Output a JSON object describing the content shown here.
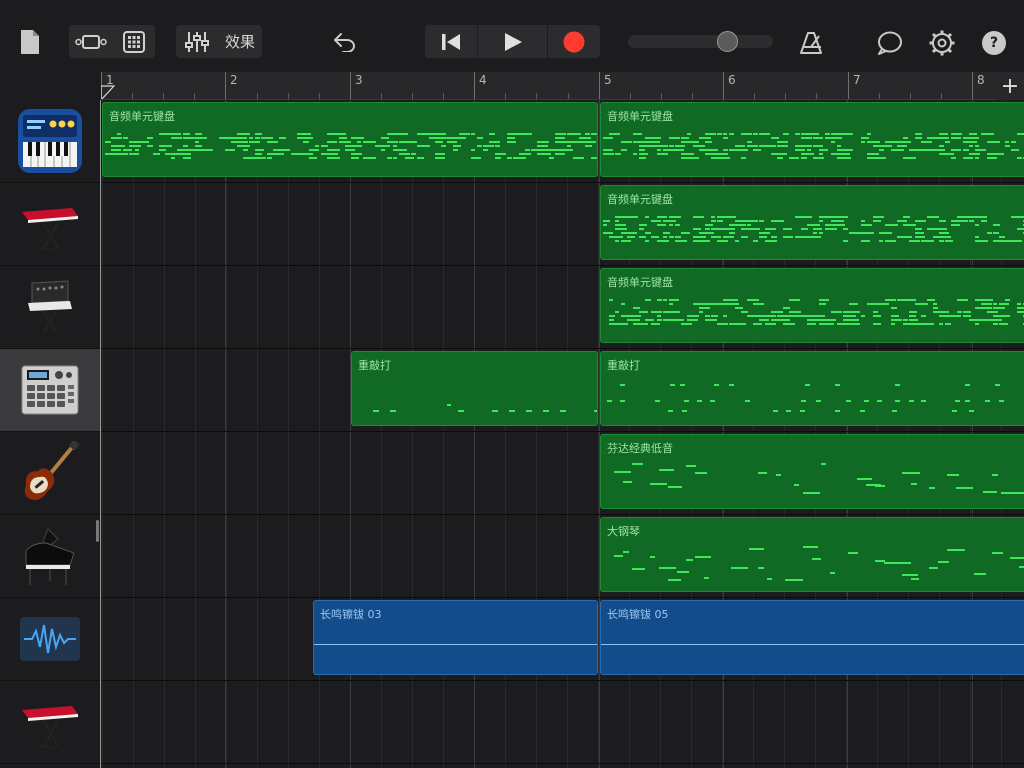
{
  "toolbar": {
    "effects_label": "效果",
    "volume_level": 0.72,
    "help_label": "?"
  },
  "ruler": {
    "bars": [
      "1",
      "2",
      "3",
      "4",
      "5",
      "6",
      "7",
      "8"
    ],
    "add_label": "+"
  },
  "tracks": [
    {
      "name": "audio-unit-keyboard",
      "instrument": "synth-app-icon"
    },
    {
      "name": "red-keyboard",
      "instrument": "keyboard-stand-icon"
    },
    {
      "name": "vintage-synth",
      "instrument": "synth-stand-icon"
    },
    {
      "name": "drum-machine",
      "instrument": "drum-machine-icon"
    },
    {
      "name": "bass",
      "instrument": "bass-guitar-icon"
    },
    {
      "name": "grand-piano",
      "instrument": "grand-piano-icon"
    },
    {
      "name": "audio-recorder",
      "instrument": "waveform-icon"
    },
    {
      "name": "red-keyboard-2",
      "instrument": "keyboard-stand-icon"
    }
  ],
  "regions": [
    {
      "track": 0,
      "label": "音频单元键盘",
      "start": 1,
      "end": 5,
      "color": "green",
      "pattern": "dense"
    },
    {
      "track": 0,
      "label": "音频单元键盘",
      "start": 5,
      "end": 9,
      "color": "green",
      "pattern": "dense"
    },
    {
      "track": 1,
      "label": "音频单元键盘",
      "start": 5,
      "end": 9,
      "color": "green",
      "pattern": "dense"
    },
    {
      "track": 2,
      "label": "音频单元键盘",
      "start": 5,
      "end": 9,
      "color": "green",
      "pattern": "dense"
    },
    {
      "track": 3,
      "label": "重敲打",
      "start": 3,
      "end": 5,
      "color": "green",
      "pattern": "drums-light"
    },
    {
      "track": 3,
      "label": "重敲打",
      "start": 5,
      "end": 9,
      "color": "green",
      "pattern": "drums"
    },
    {
      "track": 4,
      "label": "芬达经典低音",
      "start": 5,
      "end": 9,
      "color": "green",
      "pattern": "sparse"
    },
    {
      "track": 5,
      "label": "大钢琴",
      "start": 5,
      "end": 9,
      "color": "green",
      "pattern": "sparse"
    },
    {
      "track": 6,
      "label": "长鸣镲钹 03",
      "start": 2.7,
      "end": 5,
      "color": "blue",
      "pattern": "wave"
    },
    {
      "track": 6,
      "label": "长鸣镲钹 05",
      "start": 5,
      "end": 9,
      "color": "blue",
      "pattern": "wave"
    }
  ],
  "colors": {
    "midi_region": "#106a23",
    "midi_note": "#3ee65c",
    "audio_region": "#134c8a",
    "record": "#ff3b30"
  }
}
